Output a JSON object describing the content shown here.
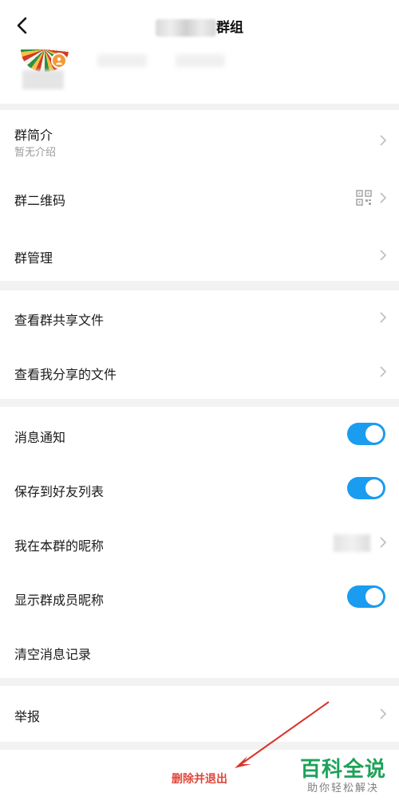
{
  "header": {
    "title_suffix": "群组",
    "back_icon": "back-chevron-icon"
  },
  "group": {
    "intro_label": "群简介",
    "intro_value": "暂无介绍",
    "qrcode_label": "群二维码",
    "manage_label": "群管理"
  },
  "files": {
    "shared_files_label": "查看群共享文件",
    "my_shared_files_label": "查看我分享的文件"
  },
  "settings": {
    "notify_label": "消息通知",
    "notify_on": true,
    "save_contacts_label": "保存到好友列表",
    "save_contacts_on": true,
    "nickname_label": "我在本群的昵称",
    "show_nicknames_label": "显示群成员昵称",
    "show_nicknames_on": true,
    "clear_history_label": "清空消息记录"
  },
  "report": {
    "label": "举报"
  },
  "footer": {
    "delete_exit_label": "删除并退出"
  },
  "watermark": {
    "main": "百科全说",
    "sub": "助你轻松解决"
  },
  "colors": {
    "toggle_on": "#1a9cf0",
    "danger": "#e0463a",
    "watermark_green": "#1ea25a",
    "arrow_red": "#d9342b"
  }
}
